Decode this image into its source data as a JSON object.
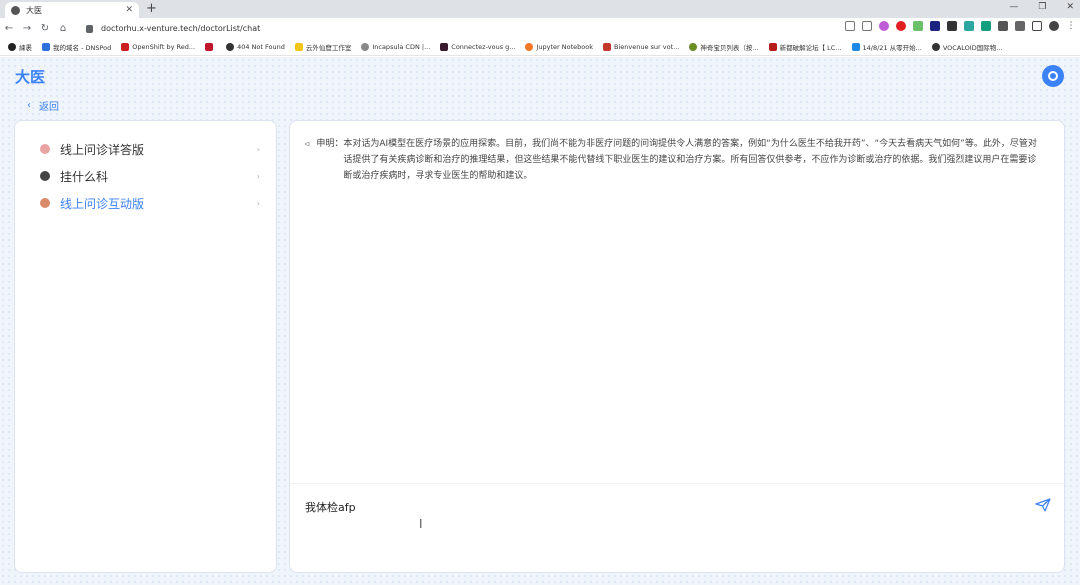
{
  "browser": {
    "tab_title": "大医",
    "url": "doctorhu.x-venture.tech/doctorList/chat",
    "bookmarks": [
      "綀褁",
      "我的域名 - DNSPod",
      "OpenShift by Red...",
      "",
      "404 Not Found",
      "云外仙窟工作室",
      "Incapsula CDN |...",
      "Connectez-vous g...",
      "Jupyter Notebook",
      "Bienvenue sur vot...",
      "神奇宝贝列表（按...",
      "新都破解论坛【 LC...",
      "14/8/21 从零开始...",
      "VOCALOID国际物..."
    ]
  },
  "app": {
    "brand": "大医",
    "back_label": "返回"
  },
  "sidebar": {
    "items": [
      {
        "label": "线上问诊详答版",
        "active": false
      },
      {
        "label": "挂什么科",
        "active": false
      },
      {
        "label": "线上问诊互动版",
        "active": true
      }
    ]
  },
  "chat": {
    "notice_label": "申明：",
    "notice_text": "本对话为AI模型在医疗场景的应用探索。目前，我们尚不能为非医疗问题的问询提供令人满意的答案，例如“为什么医生不给我开药”、“今天去看病天气如何”等。此外，尽管对话提供了有关疾病诊断和治疗的推理结果，但这些结果不能代替线下职业医生的建议和治疗方案。所有回答仅供参考，不应作为诊断或治疗的依据。我们强烈建议用户在需要诊断或治疗疾病时，寻求专业医生的帮助和建议。",
    "input_value": "我体检afp"
  },
  "colors": {
    "accent": "#3b82f6"
  }
}
